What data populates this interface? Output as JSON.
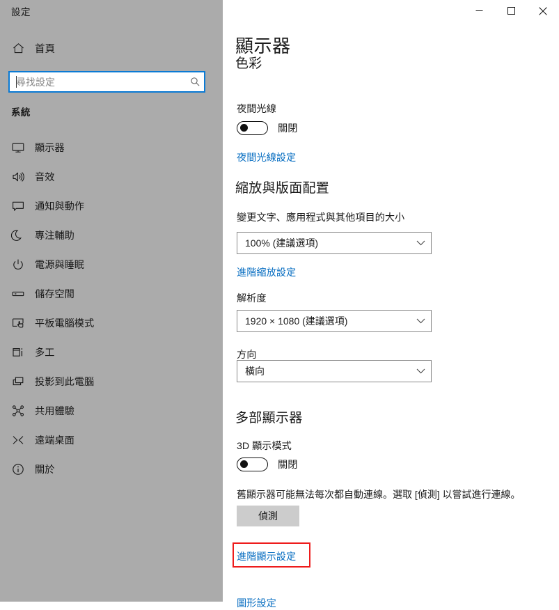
{
  "window": {
    "app_title": "設定",
    "controls": {
      "minimize": "minimize-icon",
      "maximize": "maximize-icon",
      "close": "close-icon"
    }
  },
  "sidebar": {
    "home": {
      "label": "首頁",
      "icon": "home-icon"
    },
    "search": {
      "value": "",
      "placeholder": "尋找設定",
      "icon": "search-icon"
    },
    "group_title": "系統",
    "items": [
      {
        "label": "顯示器",
        "icon": "monitor-icon"
      },
      {
        "label": "音效",
        "icon": "speaker-icon"
      },
      {
        "label": "通知與動作",
        "icon": "notification-icon"
      },
      {
        "label": "專注輔助",
        "icon": "moon-icon"
      },
      {
        "label": "電源與睡眠",
        "icon": "power-icon"
      },
      {
        "label": "儲存空間",
        "icon": "storage-icon"
      },
      {
        "label": "平板電腦模式",
        "icon": "tablet-mode-icon"
      },
      {
        "label": "多工",
        "icon": "multitasking-icon"
      },
      {
        "label": "投影到此電腦",
        "icon": "project-to-pc-icon"
      },
      {
        "label": "共用體驗",
        "icon": "shared-experiences-icon"
      },
      {
        "label": "遠端桌面",
        "icon": "remote-desktop-icon"
      },
      {
        "label": "關於",
        "icon": "info-icon"
      }
    ]
  },
  "main": {
    "page_title": "顯示器",
    "color_section": {
      "heading": "色彩",
      "night_light_label": "夜間光線",
      "night_light_state": "關閉",
      "night_light_on": false,
      "night_light_settings_link": "夜間光線設定"
    },
    "scale_section": {
      "heading": "縮放與版面配置",
      "scale_label": "變更文字、應用程式與其他項目的大小",
      "scale_value": "100% (建議選項)",
      "advanced_scaling_link": "進階縮放設定",
      "resolution_label": "解析度",
      "resolution_value": "1920 × 1080 (建議選項)",
      "orientation_label": "方向",
      "orientation_value": "橫向"
    },
    "multi_display_section": {
      "heading": "多部顯示器",
      "mode_label": "3D 顯示模式",
      "mode_state": "關閉",
      "mode_on": false,
      "detect_description": "舊顯示器可能無法每次都自動連線。選取 [偵測] 以嘗試進行連線。",
      "detect_button": "偵測",
      "advanced_display_link": "進階顯示設定",
      "graphics_settings_link": "圖形設定"
    }
  },
  "annotation": {
    "highlight_color": "#ee1c1c",
    "highlight_target": "進階顯示設定"
  },
  "colors": {
    "sidebar_bg": "#ababab",
    "content_bg": "#ffffff",
    "link": "#0a6fc2",
    "focus_border": "#0a7ad4",
    "button_bg": "#cccccc"
  }
}
